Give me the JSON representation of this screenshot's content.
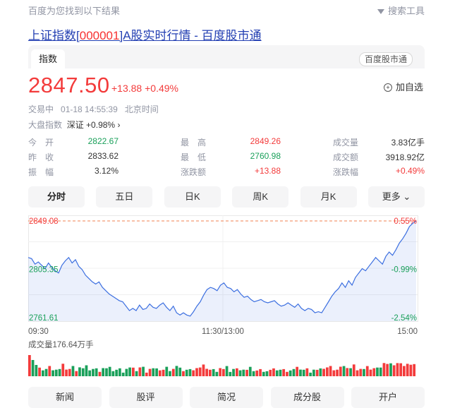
{
  "topbar": {
    "result_note": "百度为您找到以下结果",
    "search_tools": "搜索工具"
  },
  "result_title": {
    "prefix": "上证指数[",
    "code": "000001",
    "suffix": "]A股实时行情 - 百度股市通"
  },
  "tabs": {
    "active": "指数",
    "source_badge": "百度股市通"
  },
  "quote": {
    "price": "2847.50",
    "change": "+13.88",
    "change_pct": "+0.49%",
    "watch_label": "加自选",
    "status": "交易中",
    "time": "01-18 14:55:39",
    "timezone": "北京时间",
    "market_label": "大盘指数",
    "related_name": "深证",
    "related_change": "+0.98%",
    "related_arrow": "›"
  },
  "stats": [
    {
      "label": "今　开",
      "value": "2822.67",
      "color": "down"
    },
    {
      "label": "最　高",
      "value": "2849.26",
      "color": "up"
    },
    {
      "label": "成交量",
      "value": "3.83亿手",
      "color": "neutral"
    },
    {
      "label": "昨　收",
      "value": "2833.62",
      "color": "neutral"
    },
    {
      "label": "最　低",
      "value": "2760.98",
      "color": "down"
    },
    {
      "label": "成交额",
      "value": "3918.92亿",
      "color": "neutral"
    },
    {
      "label": "振　幅",
      "value": "3.12%",
      "color": "neutral"
    },
    {
      "label": "涨跌额",
      "value": "+13.88",
      "color": "up"
    },
    {
      "label": "涨跌幅",
      "value": "+0.49%",
      "color": "up"
    }
  ],
  "periods": [
    {
      "label": "分时"
    },
    {
      "label": "五日"
    },
    {
      "label": "日K"
    },
    {
      "label": "周K"
    },
    {
      "label": "月K"
    },
    {
      "label": "更多"
    }
  ],
  "chart_data": {
    "type": "line",
    "y_left_ticks": [
      "2849.08",
      "2805.35",
      "2761.61"
    ],
    "y_right_ticks": [
      "0.55%",
      "-0.99%",
      "-2.54%"
    ],
    "x_ticks": [
      "09:30",
      "11:30/13:00",
      "15:00"
    ],
    "ylim": [
      2761.61,
      2849.08
    ],
    "reference_price": 2805.35,
    "values": [
      2816,
      2815,
      2810,
      2812,
      2809,
      2806,
      2811,
      2807,
      2804,
      2802,
      2809,
      2813,
      2816,
      2811,
      2814,
      2808,
      2805,
      2800,
      2797,
      2794,
      2792,
      2794,
      2789,
      2786,
      2783,
      2781,
      2779,
      2777,
      2776,
      2772,
      2768,
      2770,
      2768,
      2773,
      2769,
      2770,
      2774,
      2771,
      2770,
      2773,
      2775,
      2771,
      2768,
      2772,
      2766,
      2764,
      2766,
      2764,
      2763,
      2767,
      2772,
      2776,
      2782,
      2787,
      2789,
      2788,
      2786,
      2791,
      2793,
      2789,
      2788,
      2785,
      2787,
      2783,
      2780,
      2781,
      2778,
      2776,
      2777,
      2778,
      2776,
      2775,
      2776,
      2777,
      2774,
      2772,
      2773,
      2775,
      2773,
      2771,
      2774,
      2770,
      2768,
      2770,
      2769,
      2766,
      2767,
      2766,
      2771,
      2776,
      2781,
      2785,
      2788,
      2793,
      2789,
      2795,
      2791,
      2798,
      2802,
      2806,
      2804,
      2808,
      2812,
      2816,
      2813,
      2810,
      2817,
      2821,
      2818,
      2823,
      2829,
      2833,
      2838,
      2844,
      2847,
      2849
    ],
    "volume": {
      "label": "成交量176.64万手",
      "total": "176.64万手"
    }
  },
  "bottom_tabs": [
    "新闻",
    "股评",
    "简况",
    "成分股",
    "开户"
  ]
}
